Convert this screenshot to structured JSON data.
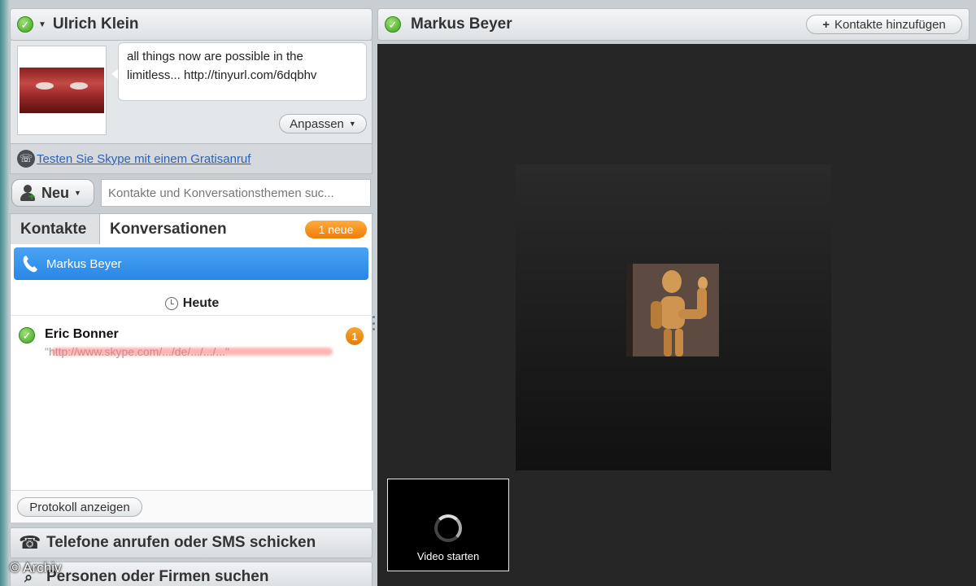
{
  "profile": {
    "name": "Ulrich Klein",
    "mood_message": "all things now are possible in the limitless... http://tinyurl.com/6dqbhv",
    "customize_label": "Anpassen"
  },
  "promo": {
    "link_text": "Testen Sie Skype mit einem Gratisanruf"
  },
  "toolbar": {
    "new_label": "Neu",
    "search_placeholder": "Kontakte und Konversationsthemen suc..."
  },
  "tabs": {
    "contacts": "Kontakte",
    "conversations": "Konversationen",
    "new_badge": "1 neue"
  },
  "conversations": {
    "selected_name": "Markus Beyer",
    "day_header": "Heute",
    "rows": [
      {
        "name": "Eric Bonner",
        "preview": "\"http://www.skype.com/.../de/.../.../...\"",
        "unread": "1"
      }
    ],
    "history_button": "Protokoll anzeigen"
  },
  "sections": {
    "phones": "Telefone anrufen oder SMS schicken",
    "people": "Personen oder Firmen suchen"
  },
  "conversation_pane": {
    "contact_name": "Markus Beyer",
    "add_contacts_label": "Kontakte hinzufügen",
    "video_start_label": "Video starten"
  },
  "watermark": "© Archiv",
  "colors": {
    "accent_blue": "#2a86e6",
    "online_green": "#3ea31e",
    "badge_orange": "#f07d07"
  },
  "icons": {
    "status": "online-check-icon",
    "new_contact": "add-person-icon",
    "call": "handset-icon",
    "clock": "clock-icon",
    "landline": "telephone-icon",
    "search_people": "magnifier-icon"
  }
}
